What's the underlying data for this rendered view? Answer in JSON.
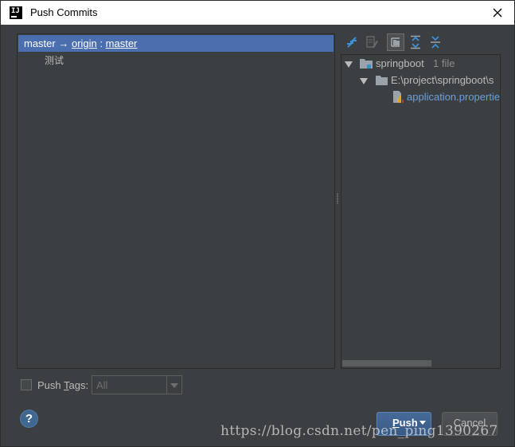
{
  "window": {
    "title": "Push Commits",
    "logo_text": "IJ"
  },
  "commits_panel": {
    "branch": {
      "local": "master",
      "arrow": "→",
      "remote": "origin",
      "separator": ":",
      "target": "master"
    },
    "commits": [
      {
        "message": "测试"
      }
    ]
  },
  "changes_toolbar": {
    "icons": [
      "compare-icon",
      "edit-source-icon",
      "group-by-directory-icon",
      "expand-all-icon",
      "collapse-all-icon"
    ]
  },
  "changes_tree": {
    "root": {
      "name": "springboot",
      "count": "1 file"
    },
    "folder": {
      "path": "E:\\project\\springboot\\s"
    },
    "file": {
      "name": "application.propertie"
    }
  },
  "push_tags": {
    "label_before": "Push ",
    "label_mnemonic": "T",
    "label_after": "ags:",
    "checked": false,
    "select_value": "All"
  },
  "buttons": {
    "help": "?",
    "push_mnemonic": "P",
    "push_rest": "ush",
    "cancel": "Cancel"
  },
  "watermark": "https://blog.csdn.net/pen_ping1390267",
  "colors": {
    "background": "#3c3f41",
    "selection": "#4b6eaf",
    "file_link": "#6a9fd9",
    "push_button": "#3d6190"
  }
}
